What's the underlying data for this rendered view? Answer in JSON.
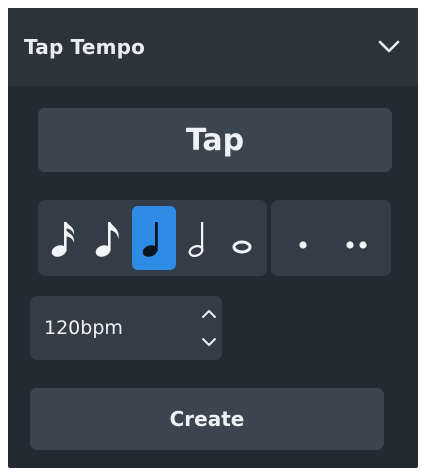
{
  "panel": {
    "title": "Tap Tempo",
    "collapse_icon": "chevron-down-icon"
  },
  "tap_button": {
    "label": "Tap"
  },
  "note_values": {
    "selected": "quarter",
    "items": [
      {
        "name": "sixteenth",
        "icon": "sixteenth-note-icon"
      },
      {
        "name": "eighth",
        "icon": "eighth-note-icon"
      },
      {
        "name": "quarter",
        "icon": "quarter-note-icon"
      },
      {
        "name": "half",
        "icon": "half-note-icon"
      },
      {
        "name": "whole",
        "icon": "whole-note-icon"
      }
    ]
  },
  "dot_options": {
    "items": [
      {
        "name": "dotted",
        "icon": "single-dot-icon"
      },
      {
        "name": "double-dotted",
        "icon": "double-dot-icon"
      }
    ]
  },
  "tempo_field": {
    "value": "120bpm",
    "stepper_up_icon": "chevron-up-icon",
    "stepper_down_icon": "chevron-down-icon"
  },
  "create_button": {
    "label": "Create"
  },
  "colors": {
    "panel_bg": "#222a33",
    "header_bg": "#2b333c",
    "button_bg": "#3b454f",
    "group_bg": "#343d47",
    "accent_selected": "#2e8ce6",
    "text": "#eef2f6"
  }
}
